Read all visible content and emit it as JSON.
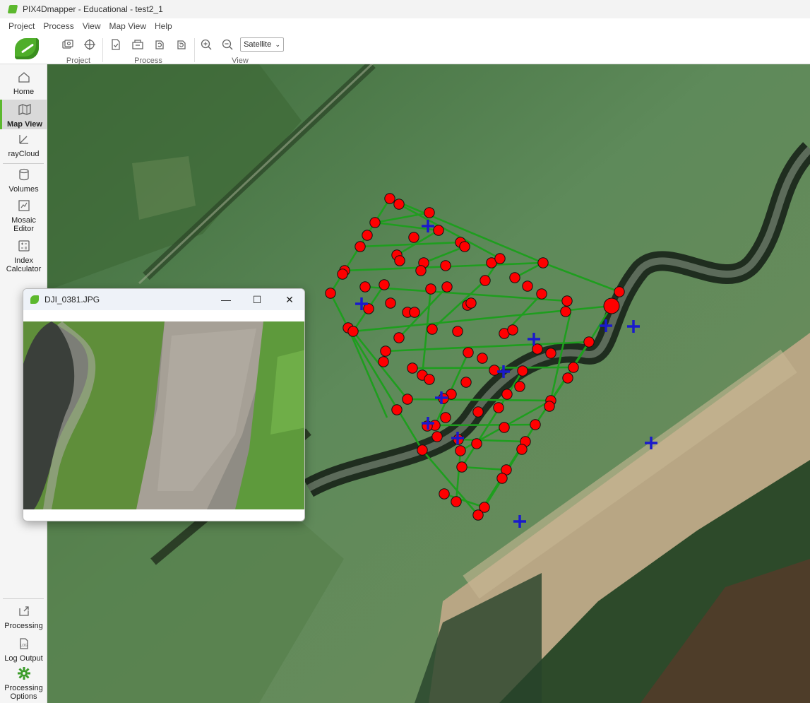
{
  "window": {
    "title": "PIX4Dmapper - Educational - test2_1"
  },
  "menu": [
    "Project",
    "Process",
    "View",
    "Map View",
    "Help"
  ],
  "toolbar": {
    "groups": [
      {
        "label": "Project",
        "icons": [
          "camera-stack-icon",
          "crosshair-icon"
        ]
      },
      {
        "label": "Process",
        "icons": [
          "check-document-icon",
          "open-folder-icon",
          "refresh-icon",
          "reprocess-icon"
        ]
      },
      {
        "label": "View",
        "icons": [
          "zoom-in-icon",
          "zoom-out-icon"
        ]
      }
    ],
    "basemap_select": "Satellite"
  },
  "sidebar": {
    "items": [
      {
        "label": "Home",
        "icon": "home-icon"
      },
      {
        "label": "Map View",
        "icon": "map-icon",
        "active": true
      },
      {
        "label": "rayCloud",
        "icon": "raycloud-icon"
      },
      {
        "label": "Volumes",
        "icon": "volumes-icon"
      },
      {
        "label": "Mosaic Editor",
        "icon": "mosaic-icon"
      },
      {
        "label": "Index Calculator",
        "icon": "calculator-icon"
      }
    ],
    "bottom_items": [
      {
        "label": "Processing",
        "icon": "processing-icon"
      },
      {
        "label": "Log Output",
        "icon": "log-icon"
      },
      {
        "label": "Processing Options",
        "icon": "gear-icon"
      }
    ]
  },
  "image_window": {
    "title": "DJI_0381.JPG"
  },
  "map": {
    "colors": {
      "camera": "#ff0000",
      "flight_line": "#1e9e1e",
      "gcp": "#1a1acc"
    }
  }
}
